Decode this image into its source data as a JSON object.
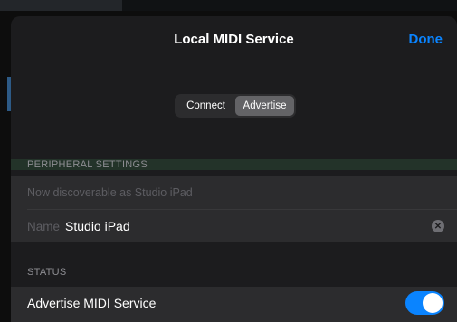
{
  "nav": {
    "title": "Local MIDI Service",
    "done_label": "Done"
  },
  "segmented": {
    "options": [
      "Connect",
      "Advertise"
    ],
    "selected": "Advertise"
  },
  "peripheral": {
    "header": "PERIPHERAL SETTINGS",
    "discoverable_text": "Now discoverable as Studio iPad",
    "name_label": "Name",
    "name_value": "Studio iPad",
    "clear_icon": "xmark-circle-icon"
  },
  "status": {
    "header": "STATUS",
    "advertise_label": "Advertise MIDI Service",
    "advertise_on": true
  },
  "colors": {
    "accent": "#0a84ff",
    "sheet": "#1c1c1e",
    "group": "#2c2c2e"
  }
}
